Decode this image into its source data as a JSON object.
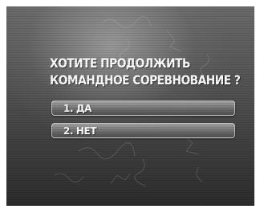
{
  "dialog": {
    "question_line1": "ХОТИТЕ ПРОДОЛЖИТЬ",
    "question_line2": "КОМАНДНОЕ СОРЕВНОВАНИЕ ?",
    "options": [
      {
        "label": "1. ДА"
      },
      {
        "label": "2. НЕТ"
      }
    ]
  },
  "colors": {
    "text": "#ffffff",
    "background": "#505050",
    "option_fill": "#8c8c8c"
  }
}
